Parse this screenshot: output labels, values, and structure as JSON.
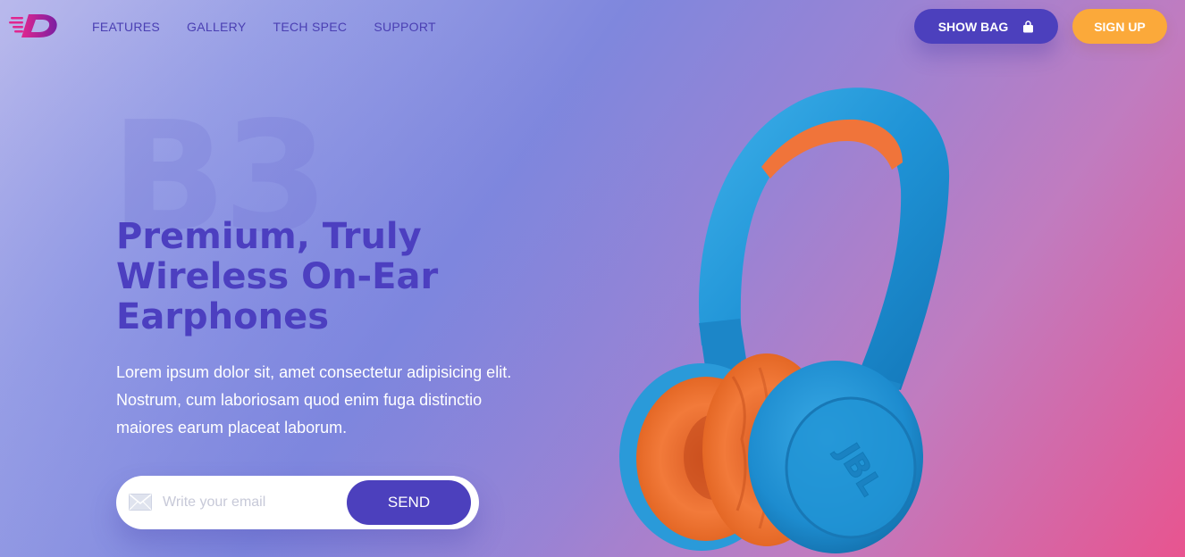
{
  "brand": {
    "logo_icon": "d-speed-logo-icon",
    "colors": {
      "primary": "#4c40bd",
      "accent": "#fba93a",
      "logo": "#c21f8f"
    }
  },
  "nav": {
    "items": [
      {
        "label": "FEATURES"
      },
      {
        "label": "GALLERY"
      },
      {
        "label": "TECH SPEC"
      },
      {
        "label": "SUPPORT"
      }
    ]
  },
  "header": {
    "show_bag_label": "SHOW BAG",
    "bag_icon": "shopping-bag-icon",
    "sign_up_label": "SIGN UP"
  },
  "hero": {
    "background_model": "B3",
    "headline_lines": [
      "Premium, Truly",
      "Wireless On-Ear",
      "Earphones"
    ],
    "description_lines": [
      "Lorem ipsum dolor sit, amet consectetur adipisicing elit.",
      "Nostrum, cum laboriosam quod enim fuga distinctio",
      "maiores earum placeat laborum."
    ],
    "product_image": "headphones-image",
    "product_brand": "JBL"
  },
  "subscribe": {
    "email_placeholder": "Write your email",
    "email_value": "",
    "mail_icon": "envelope-icon",
    "send_label": "SEND"
  }
}
